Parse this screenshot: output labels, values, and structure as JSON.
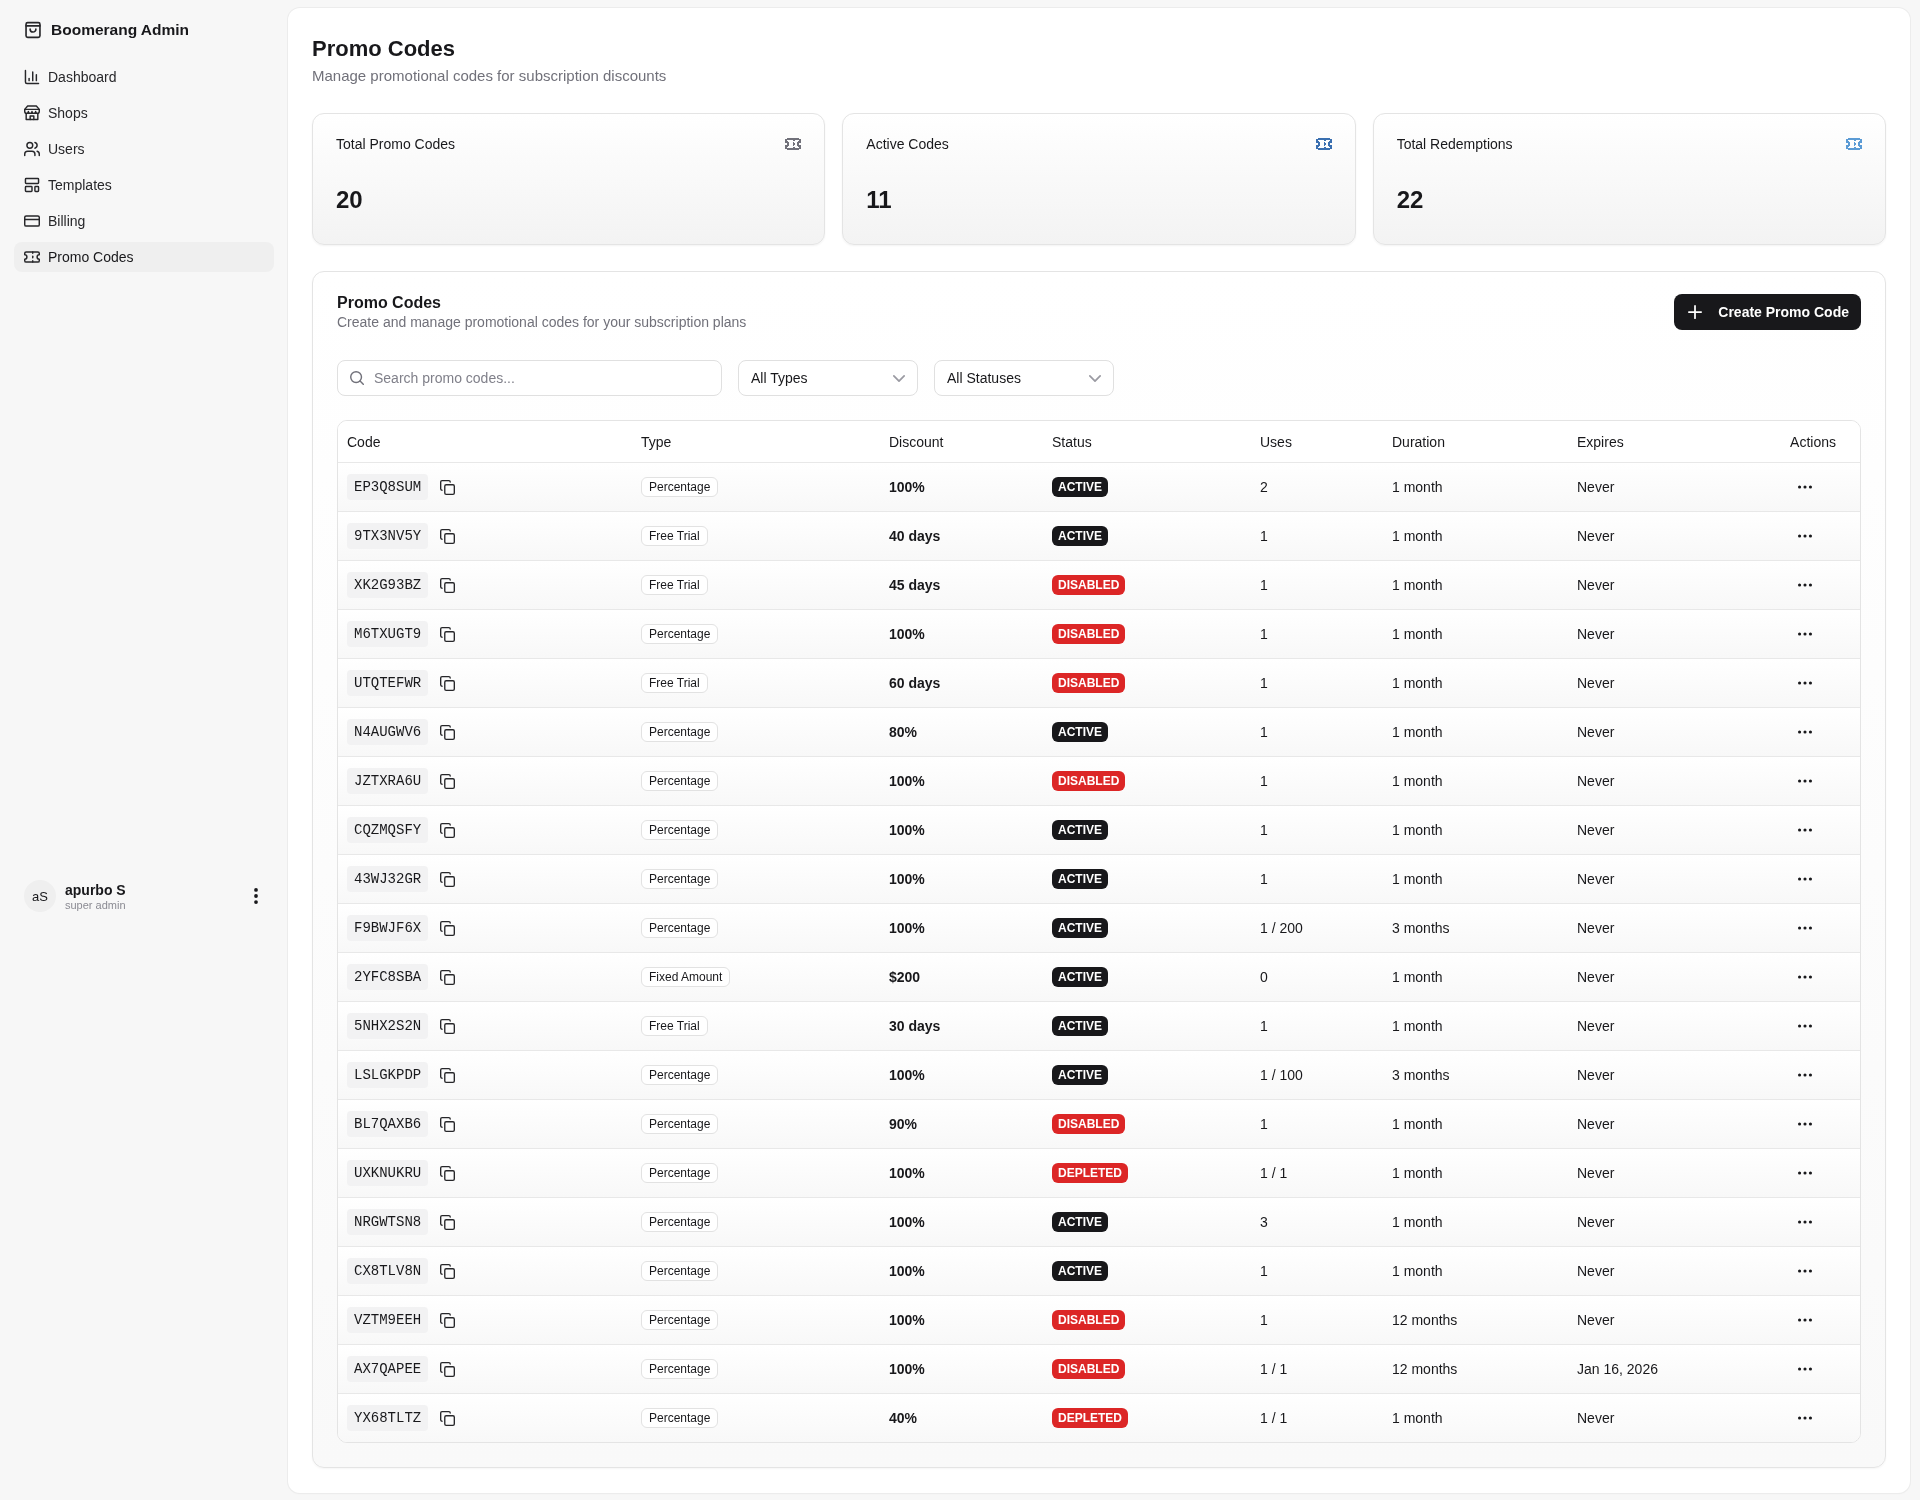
{
  "sidebar": {
    "brand": "Boomerang Admin",
    "items": [
      {
        "label": "Dashboard",
        "selected": false
      },
      {
        "label": "Shops",
        "selected": false
      },
      {
        "label": "Users",
        "selected": false
      },
      {
        "label": "Templates",
        "selected": false
      },
      {
        "label": "Billing",
        "selected": false
      },
      {
        "label": "Promo Codes",
        "selected": true
      }
    ],
    "user": {
      "initials": "aS",
      "name": "apurbo S",
      "role": "super admin"
    }
  },
  "page": {
    "title": "Promo Codes",
    "subtitle": "Manage promotional codes for subscription discounts"
  },
  "stats": [
    {
      "label": "Total Promo Codes",
      "value": "20",
      "color": "#71717a"
    },
    {
      "label": "Active Codes",
      "value": "11",
      "color": "#3a6fb0"
    },
    {
      "label": "Total Redemptions",
      "value": "22",
      "color": "#5b9bd5"
    }
  ],
  "panel": {
    "title": "Promo Codes",
    "subtitle": "Create and manage promotional codes for your subscription plans",
    "create_button": "Create Promo Code",
    "search": {
      "placeholder": "Search promo codes..."
    },
    "filters": [
      "All Types",
      "All Statuses"
    ]
  },
  "table": {
    "columns": [
      "Code",
      "Type",
      "Discount",
      "Status",
      "Uses",
      "Duration",
      "Expires",
      "Actions"
    ],
    "rows": [
      {
        "code": "EP3Q8SUM",
        "type": "Percentage",
        "discount": "100%",
        "status": {
          "label": "ACTIVE",
          "color": "#18181b"
        },
        "uses": "2",
        "duration": "1 month",
        "expires": "Never"
      },
      {
        "code": "9TX3NV5Y",
        "type": "Free Trial",
        "discount": "40 days",
        "status": {
          "label": "ACTIVE",
          "color": "#18181b"
        },
        "uses": "1",
        "duration": "1 month",
        "expires": "Never"
      },
      {
        "code": "XK2G93BZ",
        "type": "Free Trial",
        "discount": "45 days",
        "status": {
          "label": "DISABLED",
          "color": "#dc2626"
        },
        "uses": "1",
        "duration": "1 month",
        "expires": "Never"
      },
      {
        "code": "M6TXUGT9",
        "type": "Percentage",
        "discount": "100%",
        "status": {
          "label": "DISABLED",
          "color": "#dc2626"
        },
        "uses": "1",
        "duration": "1 month",
        "expires": "Never"
      },
      {
        "code": "UTQTEFWR",
        "type": "Free Trial",
        "discount": "60 days",
        "status": {
          "label": "DISABLED",
          "color": "#dc2626"
        },
        "uses": "1",
        "duration": "1 month",
        "expires": "Never"
      },
      {
        "code": "N4AUGWV6",
        "type": "Percentage",
        "discount": "80%",
        "status": {
          "label": "ACTIVE",
          "color": "#18181b"
        },
        "uses": "1",
        "duration": "1 month",
        "expires": "Never"
      },
      {
        "code": "JZTXRA6U",
        "type": "Percentage",
        "discount": "100%",
        "status": {
          "label": "DISABLED",
          "color": "#dc2626"
        },
        "uses": "1",
        "duration": "1 month",
        "expires": "Never"
      },
      {
        "code": "CQZMQSFY",
        "type": "Percentage",
        "discount": "100%",
        "status": {
          "label": "ACTIVE",
          "color": "#18181b"
        },
        "uses": "1",
        "duration": "1 month",
        "expires": "Never"
      },
      {
        "code": "43WJ32GR",
        "type": "Percentage",
        "discount": "100%",
        "status": {
          "label": "ACTIVE",
          "color": "#18181b"
        },
        "uses": "1",
        "duration": "1 month",
        "expires": "Never"
      },
      {
        "code": "F9BWJF6X",
        "type": "Percentage",
        "discount": "100%",
        "status": {
          "label": "ACTIVE",
          "color": "#18181b"
        },
        "uses": "1 / 200",
        "duration": "3 months",
        "expires": "Never"
      },
      {
        "code": "2YFC8SBA",
        "type": "Fixed Amount",
        "discount": "$200",
        "status": {
          "label": "ACTIVE",
          "color": "#18181b"
        },
        "uses": "0",
        "duration": "1 month",
        "expires": "Never"
      },
      {
        "code": "5NHX2S2N",
        "type": "Free Trial",
        "discount": "30 days",
        "status": {
          "label": "ACTIVE",
          "color": "#18181b"
        },
        "uses": "1",
        "duration": "1 month",
        "expires": "Never"
      },
      {
        "code": "LSLGKPDP",
        "type": "Percentage",
        "discount": "100%",
        "status": {
          "label": "ACTIVE",
          "color": "#18181b"
        },
        "uses": "1 / 100",
        "duration": "3 months",
        "expires": "Never"
      },
      {
        "code": "BL7QAXB6",
        "type": "Percentage",
        "discount": "90%",
        "status": {
          "label": "DISABLED",
          "color": "#dc2626"
        },
        "uses": "1",
        "duration": "1 month",
        "expires": "Never"
      },
      {
        "code": "UXKNUKRU",
        "type": "Percentage",
        "discount": "100%",
        "status": {
          "label": "DEPLETED",
          "color": "#dc2626"
        },
        "uses": "1 / 1",
        "duration": "1 month",
        "expires": "Never"
      },
      {
        "code": "NRGWTSN8",
        "type": "Percentage",
        "discount": "100%",
        "status": {
          "label": "ACTIVE",
          "color": "#18181b"
        },
        "uses": "3",
        "duration": "1 month",
        "expires": "Never"
      },
      {
        "code": "CX8TLV8N",
        "type": "Percentage",
        "discount": "100%",
        "status": {
          "label": "ACTIVE",
          "color": "#18181b"
        },
        "uses": "1",
        "duration": "1 month",
        "expires": "Never"
      },
      {
        "code": "VZTM9EEH",
        "type": "Percentage",
        "discount": "100%",
        "status": {
          "label": "DISABLED",
          "color": "#dc2626"
        },
        "uses": "1",
        "duration": "12 months",
        "expires": "Never"
      },
      {
        "code": "AX7QAPEE",
        "type": "Percentage",
        "discount": "100%",
        "status": {
          "label": "DISABLED",
          "color": "#dc2626"
        },
        "uses": "1 / 1",
        "duration": "12 months",
        "expires": "Jan 16, 2026"
      },
      {
        "code": "YX68TLTZ",
        "type": "Percentage",
        "discount": "40%",
        "status": {
          "label": "DEPLETED",
          "color": "#dc2626"
        },
        "uses": "1 / 1",
        "duration": "1 month",
        "expires": "Never"
      }
    ]
  }
}
